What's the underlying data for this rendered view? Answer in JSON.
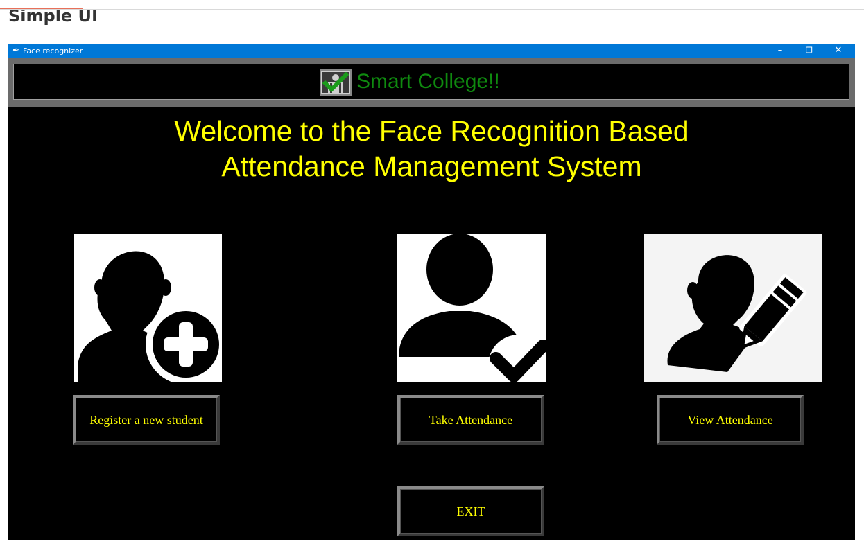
{
  "page": {
    "heading": "Simple UI"
  },
  "window": {
    "title": "Face recognizer",
    "controls": {
      "minimize": "–",
      "maximize": "❐",
      "close": "✕"
    }
  },
  "banner": {
    "text": "Smart College!!"
  },
  "welcome": {
    "line1": "Welcome to the Face Recognition Based",
    "line2": "Attendance Management System"
  },
  "tiles": [
    {
      "icon": "register-student-icon"
    },
    {
      "icon": "take-attendance-icon"
    },
    {
      "icon": "view-attendance-icon"
    }
  ],
  "buttons": {
    "register": "Register a new student",
    "take": "Take Attendance",
    "view": "View Attendance",
    "exit": "EXIT"
  },
  "colors": {
    "background": "#000000",
    "text_yellow": "#ffff00",
    "banner_green": "#0f8a0f",
    "titlebar_blue": "#0078d7"
  }
}
